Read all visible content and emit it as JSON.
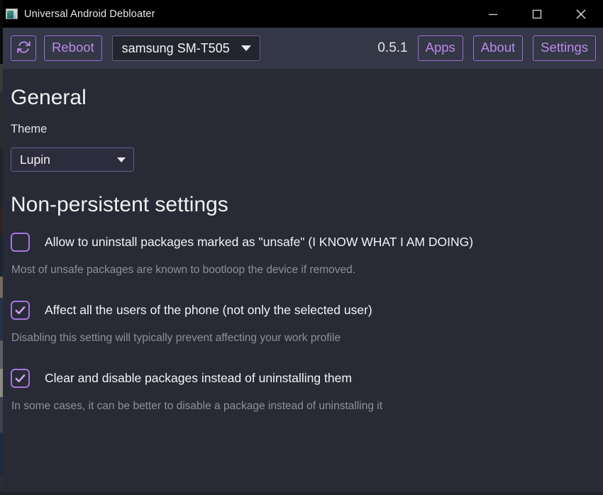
{
  "window": {
    "title": "Universal Android Debloater",
    "icon": "app-window-icon",
    "controls": {
      "minimize": "minimize-icon",
      "maximize": "maximize-icon",
      "close": "close-icon"
    }
  },
  "toolbar": {
    "refresh_icon": "refresh-icon",
    "reboot_label": "Reboot",
    "device": {
      "selected": "samsung SM-T505",
      "caret": "chevron-down-icon"
    },
    "version": "0.5.1",
    "apps_label": "Apps",
    "about_label": "About",
    "settings_label": "Settings"
  },
  "general": {
    "title": "General",
    "theme_label": "Theme",
    "theme": {
      "selected": "Lupin",
      "caret": "chevron-down-icon"
    }
  },
  "non_persistent": {
    "title": "Non-persistent settings",
    "settings": [
      {
        "label": "Allow to uninstall packages marked as \"unsafe\" (I KNOW WHAT I AM DOING)",
        "checked": false,
        "help": "Most of unsafe packages are known to bootloop the device if removed."
      },
      {
        "label": "Affect all the users of the phone (not only the selected user)",
        "checked": true,
        "help": "Disabling this setting will typically prevent affecting your work profile"
      },
      {
        "label": "Clear and disable packages instead of uninstalling them",
        "checked": true,
        "help": "In some cases, it can be better to disable a package instead of uninstalling it"
      }
    ]
  },
  "colors": {
    "window_bg": "#282b35",
    "toolbar_bg": "#343746",
    "titlebar_bg": "#000000",
    "accent_purple": "#a675e0",
    "accent_purple_text": "#b98ae8",
    "border_purple": "#6f5a8c",
    "text_primary": "#f2f2f4",
    "text_muted": "#8d8f99"
  }
}
